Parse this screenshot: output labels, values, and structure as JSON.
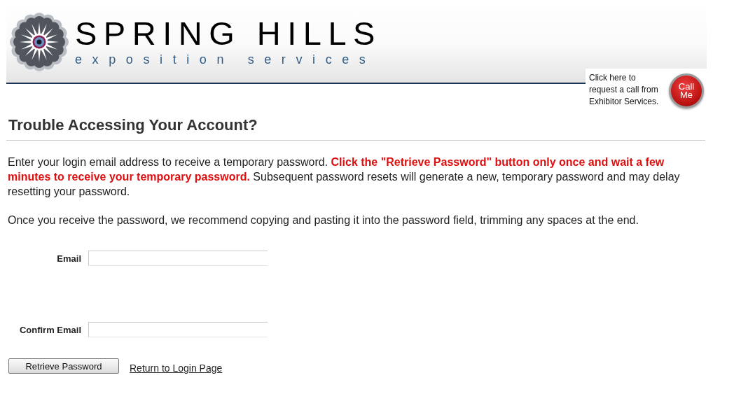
{
  "header": {
    "brand": "SPRING HILLS",
    "tagline": "exposition services"
  },
  "call_me": {
    "text": "Click here to request a call from Exhibitor Services.",
    "button": "Call Me"
  },
  "heading": "Trouble Accessing Your Account?",
  "paragraphs": [
    "Enter your login email address to receive a temporary password. **Click the \"Retrieve Password\" button only once and wait a few minutes to receive your temporary password.** Subsequent password resets will generate a new, temporary password and may delay resetting your password.",
    "Once you receive the password, we recommend copying and pasting it into the password field, trimming any spaces at the end."
  ],
  "fields": [
    {
      "label": "Email"
    },
    {
      "label": "Confirm Email"
    }
  ],
  "buttons": {
    "submit": "Retrieve Password",
    "link": "Return to Login Page"
  }
}
